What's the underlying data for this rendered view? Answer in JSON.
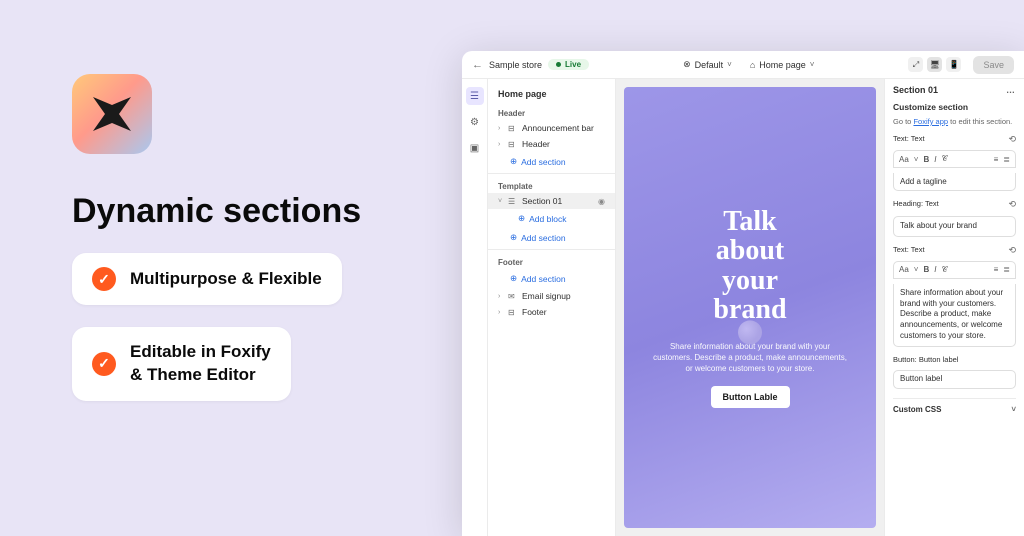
{
  "hero": {
    "title": "Dynamic sections",
    "features": [
      "Multipurpose & Flexible",
      "Editable in Foxify\n& Theme Editor"
    ]
  },
  "header": {
    "back": "←",
    "storeLabel": "Sample store",
    "live": "Live",
    "dropdownIcon": "⊗",
    "dropdown1": "Default",
    "dropdown2": "Home page",
    "homeIcon": "⌂",
    "deviceExpand": "⤢",
    "deviceDesktop": "🖥",
    "devicePhone": "📱",
    "save": "Save"
  },
  "rail": {
    "sections": "☰",
    "settings": "⚙",
    "apps": "▣"
  },
  "tree": {
    "title": "Home page",
    "groups": {
      "header": "Header",
      "template": "Template",
      "footer": "Footer"
    },
    "rows": {
      "announcement": "Announcement bar",
      "header": "Header",
      "section01": "Section 01",
      "emailSignup": "Email signup",
      "footer": "Footer"
    },
    "addBlock": "Add block",
    "addSection": "Add section",
    "plus": "⊕"
  },
  "canvas": {
    "heroLines": [
      "Talk",
      "about",
      "your",
      "brand"
    ],
    "desc": "Share information about your brand with your customers. Describe a product, make announcements, or welcome customers to your store.",
    "button": "Button Lable"
  },
  "inspector": {
    "title": "Section 01",
    "subtitle": "Customize section",
    "noteGo": "Go to ",
    "noteLink": "Foxify app",
    "noteEnd": " to edit this section.",
    "labels": {
      "text": "Text: Text",
      "heading": "Heading: Text",
      "text2": "Text: Text",
      "buttonLabel": "Button: Button label"
    },
    "formatBar": {
      "font": "Aa",
      "bold": "B",
      "italic": "I",
      "link": "𝒞",
      "list": "≡",
      "numlist": "≣"
    },
    "tagline": "Add a tagline",
    "heading": "Talk about your brand",
    "bodyText": "Share information about your brand with your customers. Describe a product, make announcements, or welcome customers to your store.",
    "buttonValue": "Button label",
    "resetGlyph": "⟲",
    "customCss": "Custom CSS",
    "chevron": "˅"
  }
}
